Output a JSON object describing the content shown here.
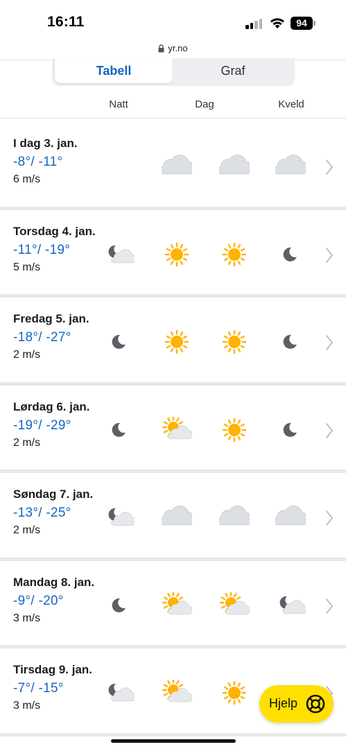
{
  "status_bar": {
    "time": "16:11",
    "battery": "94"
  },
  "browser": {
    "url": "yr.no"
  },
  "tabs": [
    {
      "label": "Tabell",
      "active": true
    },
    {
      "label": "Graf",
      "active": false
    }
  ],
  "columns": [
    "Natt",
    "Dag",
    "Kveld"
  ],
  "days": [
    {
      "name": "I dag 3. jan.",
      "temp": "-8°/ -11°",
      "wind": "6 m/s",
      "icons": {
        "night": "none",
        "day": "cloud-icon",
        "evening": "cloud-icon",
        "late": "cloud-icon"
      }
    },
    {
      "name": "Torsdag 4. jan.",
      "temp": "-11°/ -19°",
      "wind": "5 m/s",
      "icons": {
        "night": "moon-cloud-icon",
        "day": "sun-icon",
        "evening": "sun-icon",
        "late": "moon-icon"
      }
    },
    {
      "name": "Fredag 5. jan.",
      "temp": "-18°/ -27°",
      "wind": "2 m/s",
      "icons": {
        "night": "moon-icon",
        "day": "sun-icon",
        "evening": "sun-icon",
        "late": "moon-icon"
      }
    },
    {
      "name": "Lørdag 6. jan.",
      "temp": "-19°/ -29°",
      "wind": "2 m/s",
      "icons": {
        "night": "moon-icon",
        "day": "sun-cloud-icon",
        "evening": "sun-icon",
        "late": "moon-icon"
      }
    },
    {
      "name": "Søndag 7. jan.",
      "temp": "-13°/ -25°",
      "wind": "2 m/s",
      "icons": {
        "night": "moon-cloud-icon",
        "day": "cloud-icon",
        "evening": "cloud-icon",
        "late": "cloud-icon"
      }
    },
    {
      "name": "Mandag 8. jan.",
      "temp": "-9°/ -20°",
      "wind": "3 m/s",
      "icons": {
        "night": "moon-icon",
        "day": "sun-cloud-icon",
        "evening": "sun-cloud-icon",
        "late": "moon-cloud-icon"
      }
    },
    {
      "name": "Tirsdag 9. jan.",
      "temp": "-7°/ -15°",
      "wind": "3 m/s",
      "icons": {
        "night": "moon-cloud-icon",
        "day": "sun-cloud-icon",
        "evening": "sun-icon",
        "late": "moon-icon"
      }
    }
  ],
  "help_button": {
    "label": "Hjelp",
    "icon": "lifebuoy-icon"
  },
  "colors": {
    "accent": "#1565c0",
    "help": "#ffe000",
    "sun": "#ffb300",
    "moon": "#5b6068",
    "cloud": "#dcdfe3"
  }
}
